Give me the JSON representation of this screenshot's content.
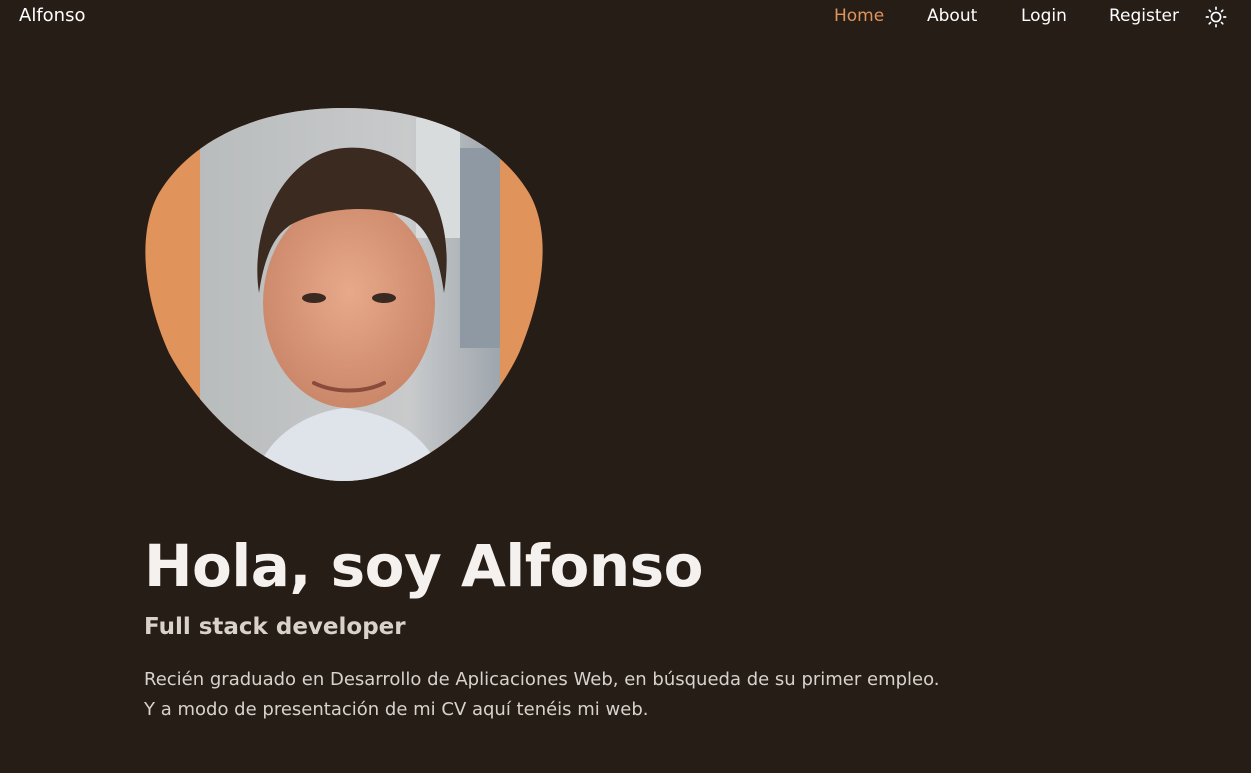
{
  "brand": "Alfonso",
  "nav": {
    "home": "Home",
    "about": "About",
    "login": "Login",
    "register": "Register"
  },
  "hero": {
    "title": "Hola, soy Alfonso",
    "subtitle": "Full stack developer",
    "description_lines": [
      "Recién graduado en Desarrollo de Aplicaciones Web, en búsqueda de su primer empleo.",
      "Y a modo de presentación de mi CV aquí tenéis mi web."
    ]
  },
  "colors": {
    "background": "#261d17",
    "accent": "#e0935a",
    "text": "#ffffff"
  },
  "icons": {
    "theme_toggle": "sun-icon"
  }
}
